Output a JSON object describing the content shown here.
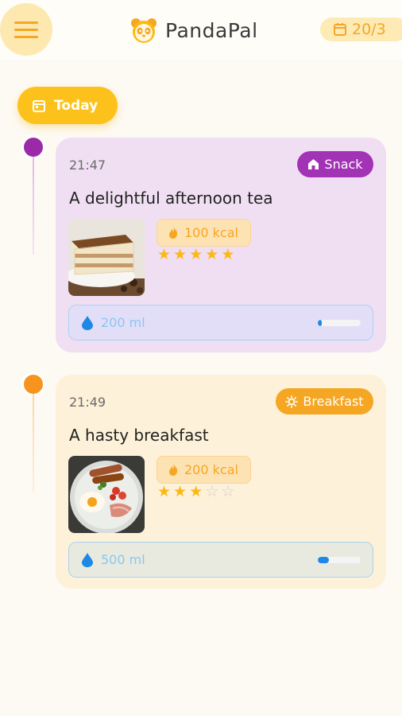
{
  "header": {
    "app_name": "PandaPal",
    "date": "20/3",
    "icons": {
      "menu": "hamburger-icon",
      "logo": "panda-icon",
      "date": "calendar-icon"
    }
  },
  "timeline": {
    "day_label": "Today"
  },
  "entries": [
    {
      "time": "21:47",
      "category": "Snack",
      "category_icon": "home-icon",
      "title": "A delightful afternoon tea",
      "kcal": "100 kcal",
      "rating": 5,
      "rating_max": 5,
      "water": "200 ml",
      "water_progress": 0.1,
      "photo": "tiramisu-photo",
      "colors": {
        "accent": "#a233b5",
        "card": "#f0dff3"
      }
    },
    {
      "time": "21:49",
      "category": "Breakfast",
      "category_icon": "sun-icon",
      "title": "A hasty breakfast",
      "kcal": "200 kcal",
      "rating": 3,
      "rating_max": 5,
      "water": "500 ml",
      "water_progress": 0.25,
      "photo": "english-breakfast-photo",
      "colors": {
        "accent": "#f5a623",
        "card": "#fdf1d9"
      }
    }
  ],
  "colors": {
    "primary": "#fcc21b",
    "water": "#1e88e5",
    "background": "#fdfaf3"
  }
}
